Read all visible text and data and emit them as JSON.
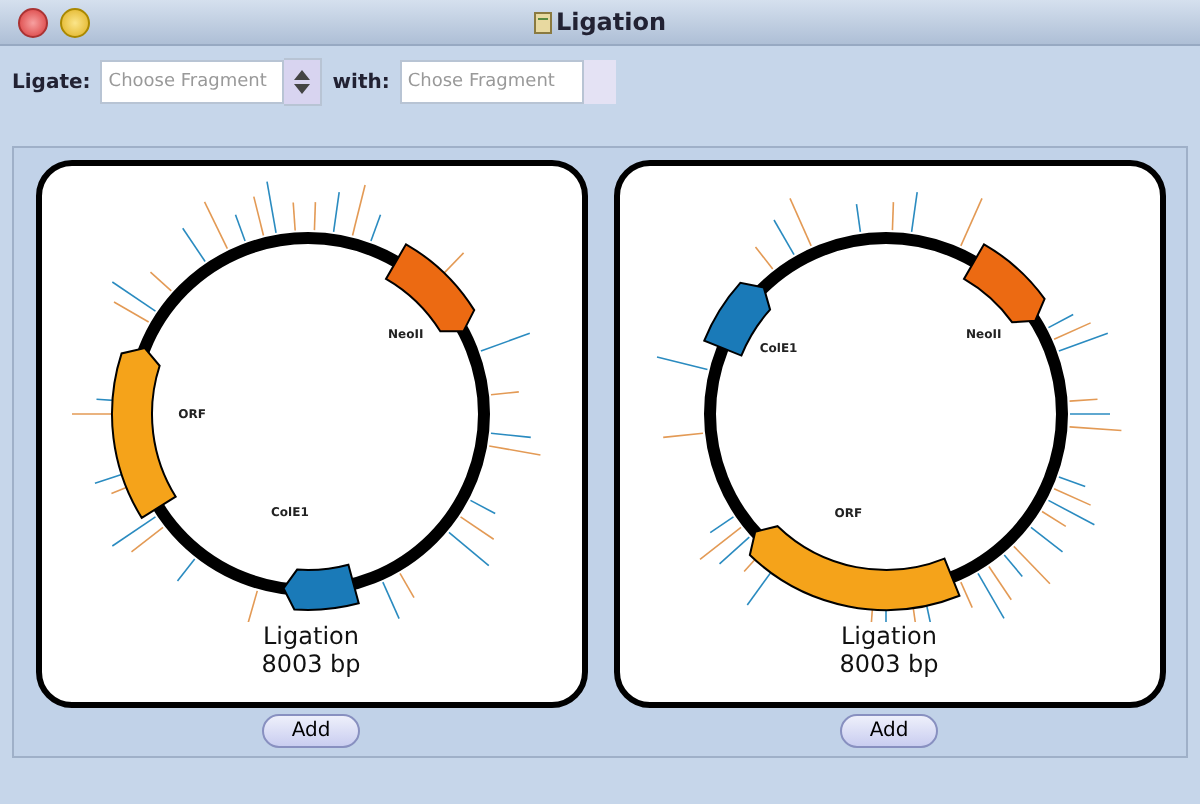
{
  "window": {
    "title": "Ligation"
  },
  "toolbar": {
    "ligate_label": "Ligate:",
    "fragment_select": {
      "placeholder": "Choose Fragment"
    },
    "with_label": "with:",
    "with_field": {
      "placeholder": "Chose Fragment"
    }
  },
  "panels": [
    {
      "features": [
        {
          "label": "ORF",
          "color": "#f5a31a"
        },
        {
          "label": "NeoII",
          "color": "#ec6a12"
        },
        {
          "label": "ColE1",
          "color": "#1a7ab8"
        }
      ],
      "name": "Ligation",
      "size": "8003 bp",
      "button": "Add"
    },
    {
      "features": [
        {
          "label": "ColE1",
          "color": "#1a7ab8"
        },
        {
          "label": "NeoII",
          "color": "#ec6a12"
        },
        {
          "label": "ORF",
          "color": "#f5a31a"
        }
      ],
      "name": "Ligation",
      "size": "8003 bp",
      "button": "Add"
    }
  ]
}
